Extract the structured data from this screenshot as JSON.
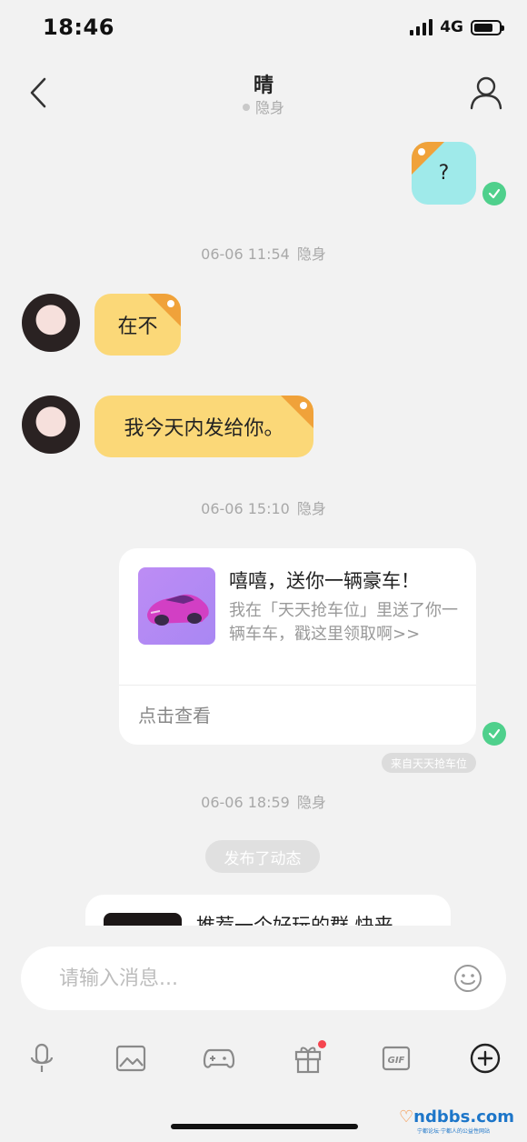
{
  "status_bar": {
    "time": "18:46",
    "network": "4G"
  },
  "header": {
    "title": "晴",
    "status": "隐身",
    "back_icon": "chevron-left-icon",
    "profile_icon": "user-icon"
  },
  "messages": {
    "outgoing_question": "?",
    "timestamp_1": {
      "time": "06-06 11:54",
      "status": "隐身"
    },
    "incoming_1": "在不",
    "incoming_2": "我今天内发给你。",
    "timestamp_2": {
      "time": "06-06 15:10",
      "status": "隐身"
    },
    "share_card": {
      "title": "嘻嘻，送你一辆豪车！",
      "description": "我在「天天抢车位」里送了你一辆车车，戳这里领取啊>>",
      "action": "点击查看",
      "source": "来自天天抢车位"
    },
    "timestamp_3": {
      "time": "06-06 18:59",
      "status": "隐身"
    },
    "system_notice": "发布了动态",
    "partial_card": {
      "title": "推荐一个好玩的群 快来"
    }
  },
  "input": {
    "placeholder": "请输入消息..."
  },
  "toolbar": {
    "items": [
      "microphone-icon",
      "image-icon",
      "gamepad-icon",
      "gift-icon",
      "gif-icon",
      "plus-circle-icon"
    ]
  },
  "watermark": {
    "brand": "ndbbs",
    "domain": ".com",
    "tagline": "宁都论坛·宁都人的公益性网站"
  },
  "colors": {
    "background": "#f2f2f2",
    "outgoing_bubble": "#9feaea",
    "incoming_bubble": "#fbd878",
    "tag_orange": "#f0a23a",
    "read_check": "#4fd08c",
    "gift_badge": "#f5454f"
  }
}
